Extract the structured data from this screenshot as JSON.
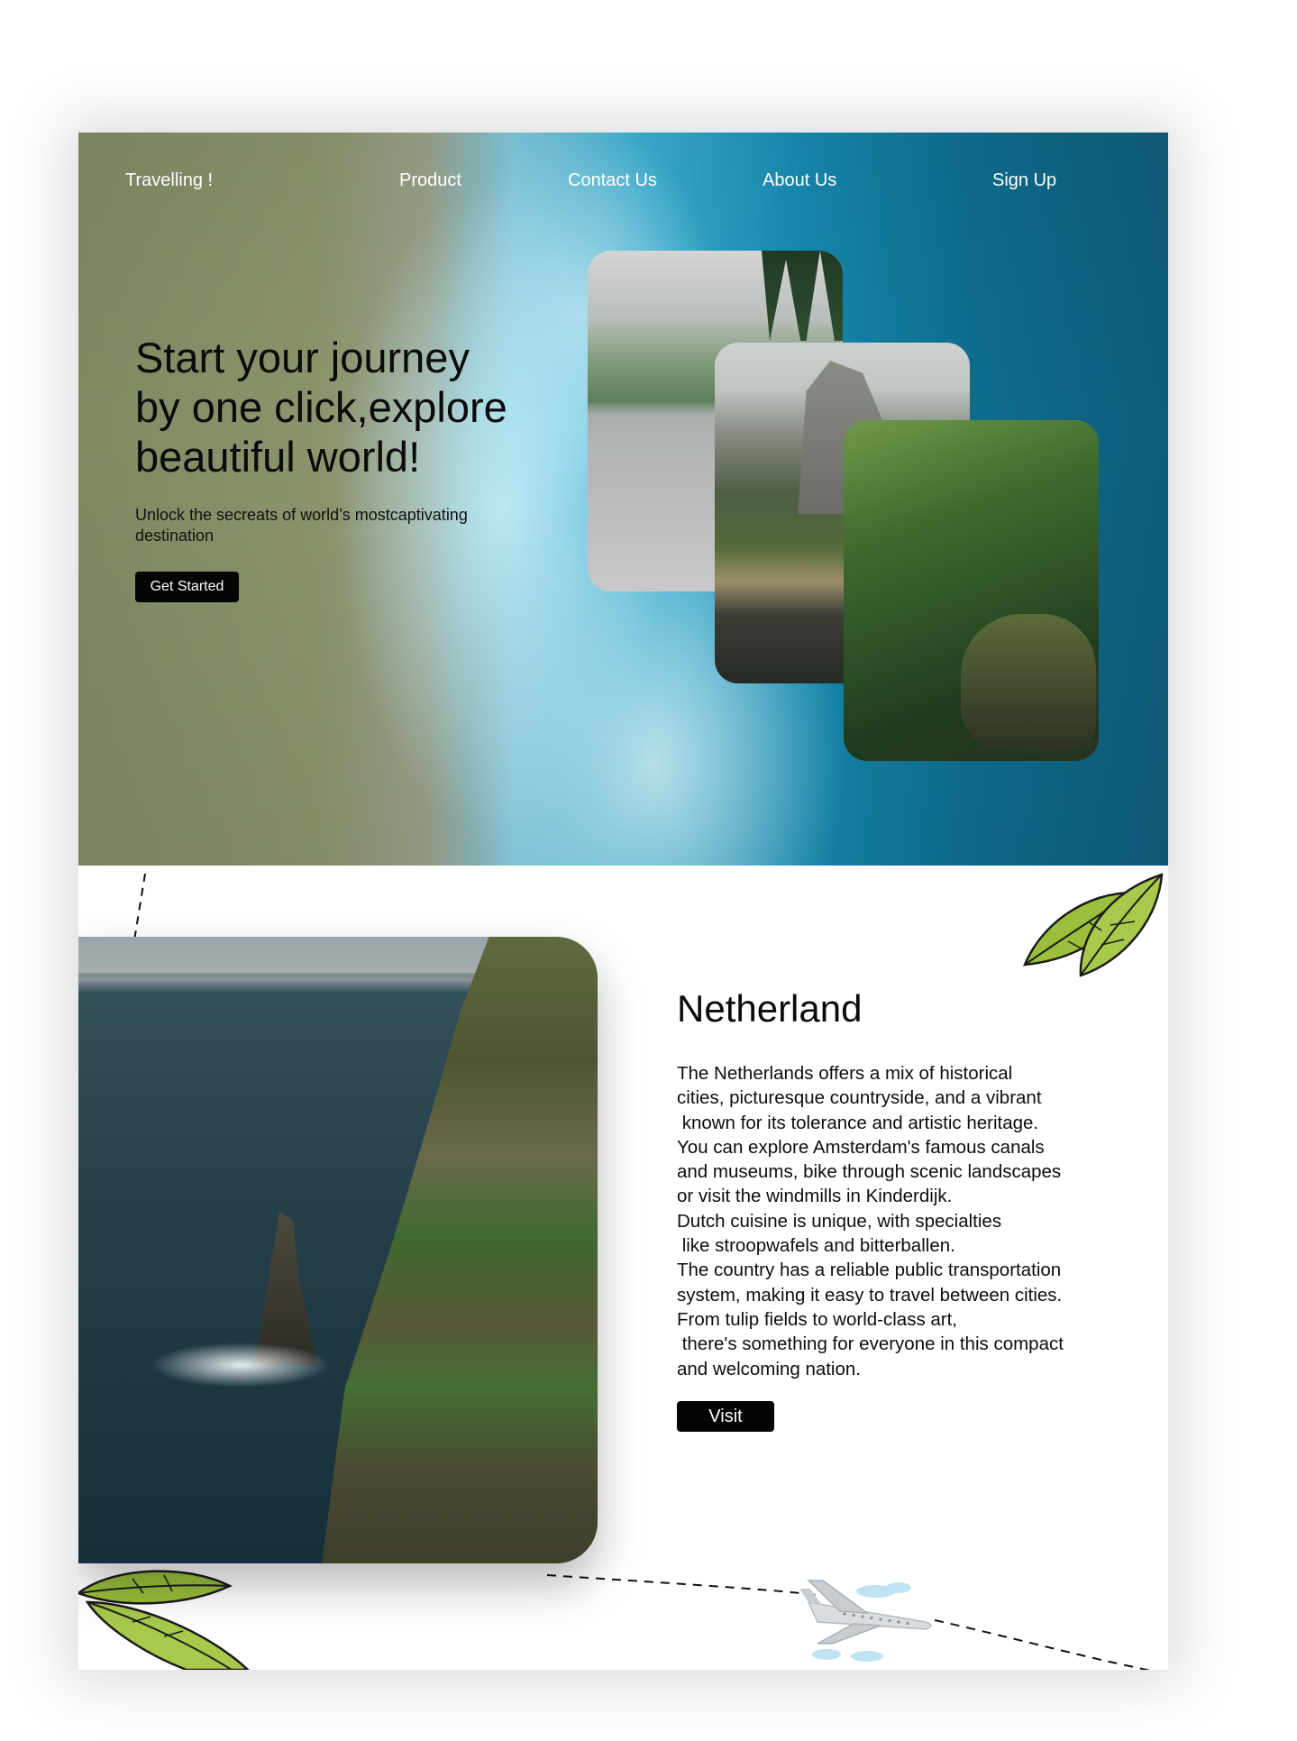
{
  "nav": {
    "brand": "Travelling !",
    "items": [
      {
        "label": "Product"
      },
      {
        "label": "Contact Us"
      },
      {
        "label": "About Us"
      },
      {
        "label": "Sign Up"
      }
    ]
  },
  "hero": {
    "title_lines": [
      "Start your journey",
      "by one click,explore",
      "beautiful world!"
    ],
    "subtitle": "Unlock the secreats of world’s mostcaptivating destination",
    "cta_label": "Get Started",
    "cards": [
      {
        "photo": "mountain-lake"
      },
      {
        "photo": "granite-cliff-forest"
      },
      {
        "photo": "forest-trail"
      }
    ]
  },
  "destination": {
    "photo": "sea-cliffs",
    "title": "Netherland",
    "description_lines": [
      "The Netherlands offers a mix of historical",
      "cities, picturesque countryside, and a vibrant",
      " known for its tolerance and artistic heritage.",
      "You can explore Amsterdam's famous canals",
      "and museums, bike through scenic landscapes",
      "or visit the windmills in Kinderdijk.",
      "Dutch cuisine is unique, with specialties",
      " like stroopwafels and bitterballen.",
      "The country has a reliable public transportation",
      "system, making it easy to travel between cities.",
      "From tulip fields to world-class art,",
      " there's something for everyone in this compact",
      "and welcoming nation."
    ],
    "cta_label": "Visit"
  },
  "decor": {
    "leaf_icon": "leaf-icon",
    "plane_icon": "airplane-icon",
    "leaf_color": "#9bbf3c",
    "accent_black": "#050505"
  }
}
